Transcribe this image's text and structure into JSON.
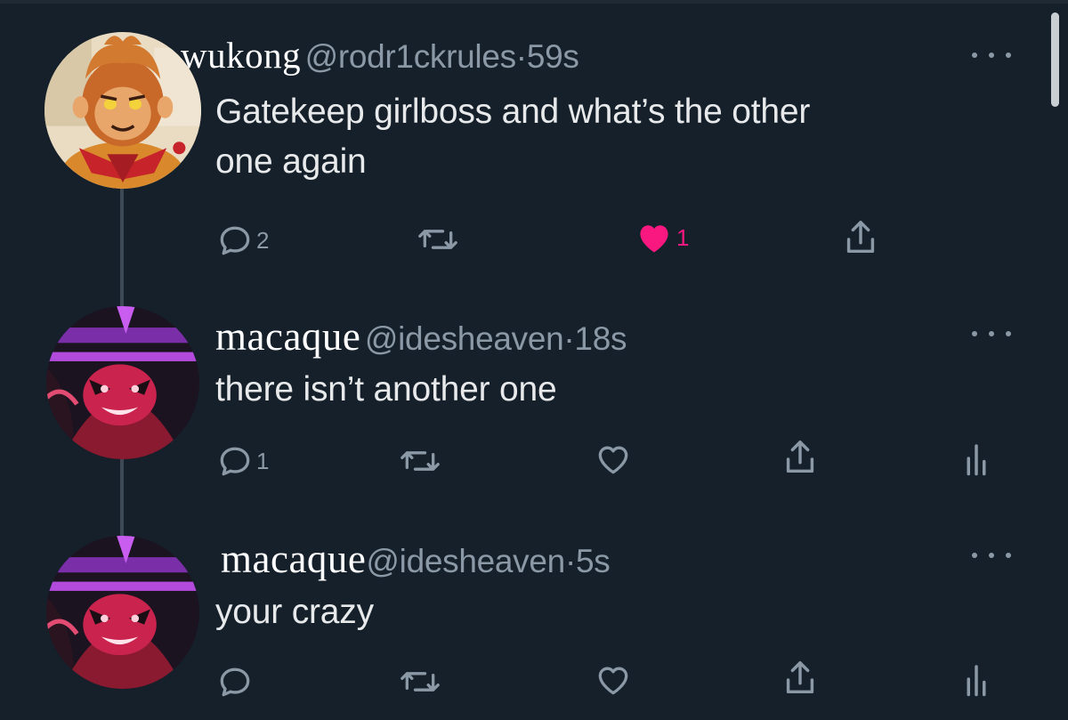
{
  "tweets": [
    {
      "display_name": "wukong",
      "handle": "@rodr1ckrules",
      "time": "59s",
      "text_lines": [
        "Gatekeep girlboss and what’s the other",
        "one again"
      ],
      "actions": {
        "reply_count": "2",
        "retweet_count": "",
        "like_count": "1",
        "liked": true,
        "has_analytics": false
      }
    },
    {
      "display_name": "macaque",
      "handle": "@idesheaven",
      "time": "18s",
      "text_lines": [
        "there isn’t another one"
      ],
      "actions": {
        "reply_count": "1",
        "retweet_count": "",
        "like_count": "",
        "liked": false,
        "has_analytics": true
      }
    },
    {
      "display_name": "macaque",
      "handle": "@idesheaven",
      "time": "5s",
      "text_lines": [
        "your crazy"
      ],
      "actions": {
        "reply_count": "",
        "retweet_count": "",
        "like_count": "",
        "liked": false,
        "has_analytics": true
      }
    }
  ],
  "separator": "·",
  "icons": {
    "reply": "reply-icon",
    "retweet": "retweet-icon",
    "like": "heart-icon",
    "share": "share-icon",
    "analytics": "analytics-icon",
    "more": "more-options-icon"
  },
  "colors": {
    "background": "#15202b",
    "text": "#e7e9ea",
    "secondary_text": "#8b98a5",
    "like_active": "#f91880",
    "thread_line": "#3d4a55"
  }
}
